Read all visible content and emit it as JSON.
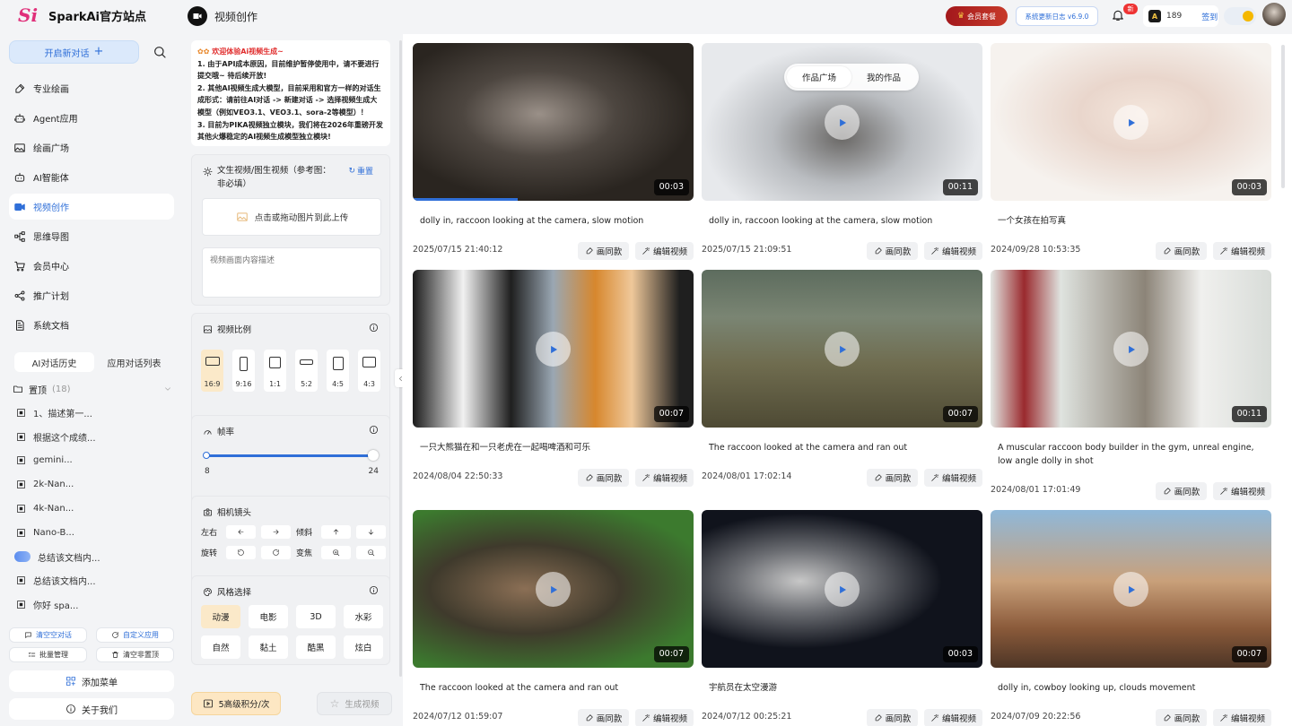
{
  "app": {
    "logo_mark": "Si",
    "title": "SparkAi官方站点"
  },
  "sidebar": {
    "new_chat": "开启新对话",
    "nav": [
      {
        "label": "专业绘画",
        "icon": "brush-icon"
      },
      {
        "label": "Agent应用",
        "icon": "robot-icon"
      },
      {
        "label": "绘画广场",
        "icon": "image-icon"
      },
      {
        "label": "AI智能体",
        "icon": "bot-icon"
      },
      {
        "label": "视频创作",
        "icon": "video-icon",
        "active": true
      },
      {
        "label": "思维导图",
        "icon": "mindmap-icon"
      },
      {
        "label": "会员中心",
        "icon": "cart-icon"
      },
      {
        "label": "推广计划",
        "icon": "share-icon"
      },
      {
        "label": "系统文档",
        "icon": "doc-icon"
      }
    ],
    "history_tabs": [
      "AI对话历史",
      "应用对话列表"
    ],
    "pinned_label": "置顶",
    "pinned_count": "(18)",
    "history": [
      "1、描述第一...",
      "根据这个成绩...",
      "gemini...",
      "2k-Nan...",
      "4k-Nan...",
      "Nano-B...",
      "总结该文档内...",
      "总结该文档内...",
      "你好 spa..."
    ],
    "quick": [
      "清空空对话",
      "自定义应用",
      "批量管理",
      "清空非置顶"
    ],
    "add_menu": "添加菜单",
    "about": "关于我们"
  },
  "header": {
    "page_title": "视频创作",
    "vip": "会员套餐",
    "update": "系统更新日志 v6.9.0",
    "bell_badge": "新",
    "coin_label": "A",
    "points": "189",
    "signin": "签到"
  },
  "form": {
    "notice_title": "欢迎体验Ai视频生成~",
    "notice_lines": [
      "1. 由于API成本原因，目前维护暂停使用中，请不要进行提交哦~ 待后续开放!",
      "2. 其他AI视频生成大模型，目前采用和官方一样的对话生成形式：请前往AI对话 -> 新建对话 -> 选择视频生成大模型（例如VEO3.1、VEO3.1、sora-2等模型）！",
      "3. 目前为PIKA视频独立模块，我们将在2026年重磅开发其他火爆稳定的AI视频生成模型独立模块!"
    ],
    "text2video_title": "文生视频/图生视频（参考图：非必填）",
    "reset": "重置",
    "upload": "点击或拖动图片到此上传",
    "desc_placeholder": "视频画面内容描述",
    "ratio_title": "视频比例",
    "ratios": [
      "16:9",
      "9:16",
      "1:1",
      "5:2",
      "4:5",
      "4:3"
    ],
    "ratio_selected": "16:9",
    "fps_title": "帧率",
    "fps_min": "8",
    "fps_max": "24",
    "fps_value": 24,
    "camera_title": "相机镜头",
    "camera_rows": [
      {
        "label": "左右",
        "tilt_label": "倾斜",
        "icons": [
          "arrow-left-icon",
          "arrow-right-icon",
          "arrow-up-icon",
          "arrow-down-icon"
        ]
      },
      {
        "label": "旋转",
        "tilt_label": "变焦",
        "icons": [
          "rotate-ccw-icon",
          "rotate-cw-icon",
          "zoom-in-icon",
          "zoom-out-icon"
        ]
      }
    ],
    "style_title": "风格选择",
    "styles": [
      "动漫",
      "电影",
      "3D",
      "水彩",
      "自然",
      "黏土",
      "酷黑",
      "炫白"
    ],
    "style_selected": "动漫",
    "cost": "5高级积分/次",
    "generate": "生成视频"
  },
  "gallery": {
    "tabs": [
      "作品广场",
      "我的作品"
    ],
    "active_tab": "作品广场",
    "action_same": "画同款",
    "action_edit": "编辑视频",
    "items": [
      {
        "title": "dolly in, raccoon looking at the camera, slow motion",
        "date": "2025/07/15 21:40:12",
        "duration": "00:03",
        "playing": true
      },
      {
        "title": "dolly in, raccoon looking at the camera, slow motion",
        "date": "2025/07/15 21:09:51",
        "duration": "00:11"
      },
      {
        "title": "一个女孩在拍写真",
        "date": "2024/09/28 10:53:35",
        "duration": "00:03"
      },
      {
        "title": "一只大熊猫在和一只老虎在一起喝啤酒和可乐",
        "date": "2024/08/04 22:50:33",
        "duration": "00:07"
      },
      {
        "title": "The raccoon looked at the camera and ran out",
        "date": "2024/08/01 17:02:14",
        "duration": "00:07"
      },
      {
        "title": "A muscular raccoon body builder in the gym, unreal engine, low angle dolly in shot",
        "date": "2024/08/01 17:01:49",
        "duration": "00:11"
      },
      {
        "title": "The raccoon looked at the camera and ran out",
        "date": "2024/07/12 01:59:07",
        "duration": "00:07"
      },
      {
        "title": "宇航员在太空漫游",
        "date": "2024/07/12 00:25:21",
        "duration": "00:03"
      },
      {
        "title": "dolly in, cowboy looking up, clouds movement",
        "date": "2024/07/09 20:22:56",
        "duration": "00:07"
      }
    ]
  },
  "colors": {
    "accent": "#2f6fd8",
    "selected_option": "#fbe9c9",
    "vip": "#b52622",
    "danger": "#e02d2d"
  }
}
